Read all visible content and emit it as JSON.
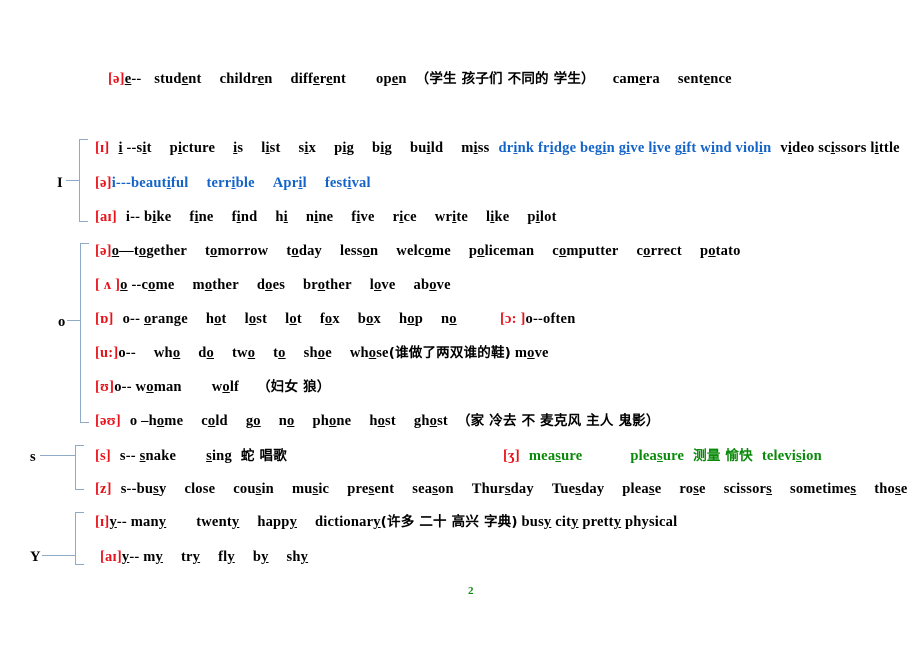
{
  "document": {
    "page_number": "2",
    "colors": {
      "ipa_red": "#e8121a",
      "blue": "#1464c8",
      "green": "#0a8a0a",
      "bracket": "#8fa9c8",
      "text": "#000000"
    }
  },
  "top_line": {
    "ipa": "[ə]",
    "rule": "e--",
    "words": "student   children   different   open",
    "gloss": "（学生 孩子们 不同的 学生）",
    "tail": "camera   sentence"
  },
  "groups": [
    {
      "letter": "I",
      "rows": [
        {
          "ipa": "[ɪ]",
          "rule": "i --sit",
          "words_black": "picture   is   list   six   pig   big   build   miss",
          "words_blue": "drink fridge begin give live gift wind violin",
          "words_black_tail": "video scissors little"
        },
        {
          "ipa": "[ə]",
          "rule": "i---",
          "words_blue": "beautiful   terrible   April   festival"
        },
        {
          "ipa": "[aɪ]",
          "rule": "i-- bike",
          "words_black": "fine   find   hi   nine   five   rice   write   like   pilot"
        }
      ]
    },
    {
      "letter": "o",
      "rows": [
        {
          "ipa": "[ə]",
          "rule": "o—together",
          "words_black": "tomorrow   today   lesson   welcome   policeman   computter   correct   potato"
        },
        {
          "ipa": "[ ʌ ]",
          "rule": "o --come",
          "words_black": "mother   does   brother   love   above"
        },
        {
          "ipa": "[ɒ]",
          "rule": "o-- orange",
          "words_black": "hot   lost   lot   fox   box   hop   no",
          "extra_ipa": "[ɔ: ]",
          "extra_rule": "o--often"
        },
        {
          "ipa": "[u:]",
          "rule": "o--",
          "words_black": "who   do   two   to   shoe   whose",
          "gloss": "(谁做了两双谁的鞋)",
          "tail": "move"
        },
        {
          "ipa": "[ʊ]",
          "rule": "o-- woman",
          "words_black": "wolf",
          "gloss": "（妇女 狼）"
        },
        {
          "ipa": "[əʊ]",
          "rule": "o --home",
          "words_black": "cold   go   no   phone   host   ghost",
          "gloss": "（家 冷去 不 麦克风 主人 鬼影）"
        }
      ]
    },
    {
      "letter": "s",
      "rows": [
        {
          "ipa": "[s]",
          "rule": "s-- snake",
          "words_black": "sing",
          "gloss": "蛇  唱歌",
          "extra_ipa": "[ʒ]",
          "extra_green": "measure",
          "extra_green2": "pleasure",
          "extra_gloss": "测量  愉快",
          "extra_green3": "television"
        },
        {
          "ipa": "[z]",
          "rule": "s--busy",
          "words_black": "close   cousin   music   present   season   Thursday   Tuesday   please   rose   scissors   sometimes   those"
        }
      ]
    },
    {
      "letter": "Y",
      "rows": [
        {
          "ipa": "[ɪ]",
          "rule": "y-- many",
          "words_black": "twenty   happy   dictionary",
          "gloss": "(许多 二十 高兴 字典)",
          "tail": "busy city pretty physical"
        },
        {
          "ipa": "[aɪ]",
          "rule": "y-- my",
          "words_black": "try   fly   by   shy"
        }
      ]
    }
  ]
}
